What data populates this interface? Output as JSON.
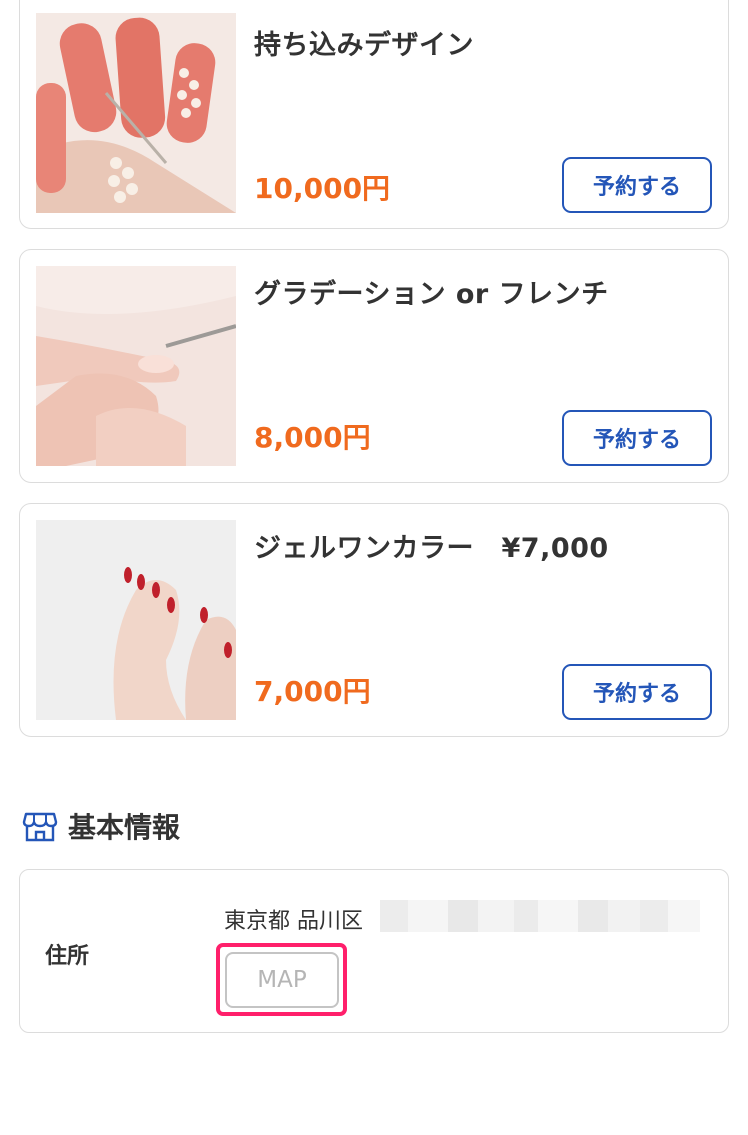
{
  "menu_items": [
    {
      "title": "持ち込みデザイン",
      "price": "10,000円",
      "button": "予約する",
      "image": "coral-glitter-nails-photo"
    },
    {
      "title": "グラデーション or フレンチ",
      "price": "8,000円",
      "button": "予約する",
      "image": "nail-care-photo"
    },
    {
      "title": "ジェルワンカラー　¥7,000",
      "price": "7,000円",
      "button": "予約する",
      "image": "red-gel-nails-photo"
    }
  ],
  "basic_info": {
    "heading": "基本情報",
    "icon": "store-icon",
    "address_label": "住所",
    "address_text": "東京都 品川区",
    "map_button": "MAP"
  },
  "colors": {
    "accent_blue": "#2456b8",
    "price_orange": "#f06a1e",
    "highlight_pink": "#ff1f6b"
  }
}
